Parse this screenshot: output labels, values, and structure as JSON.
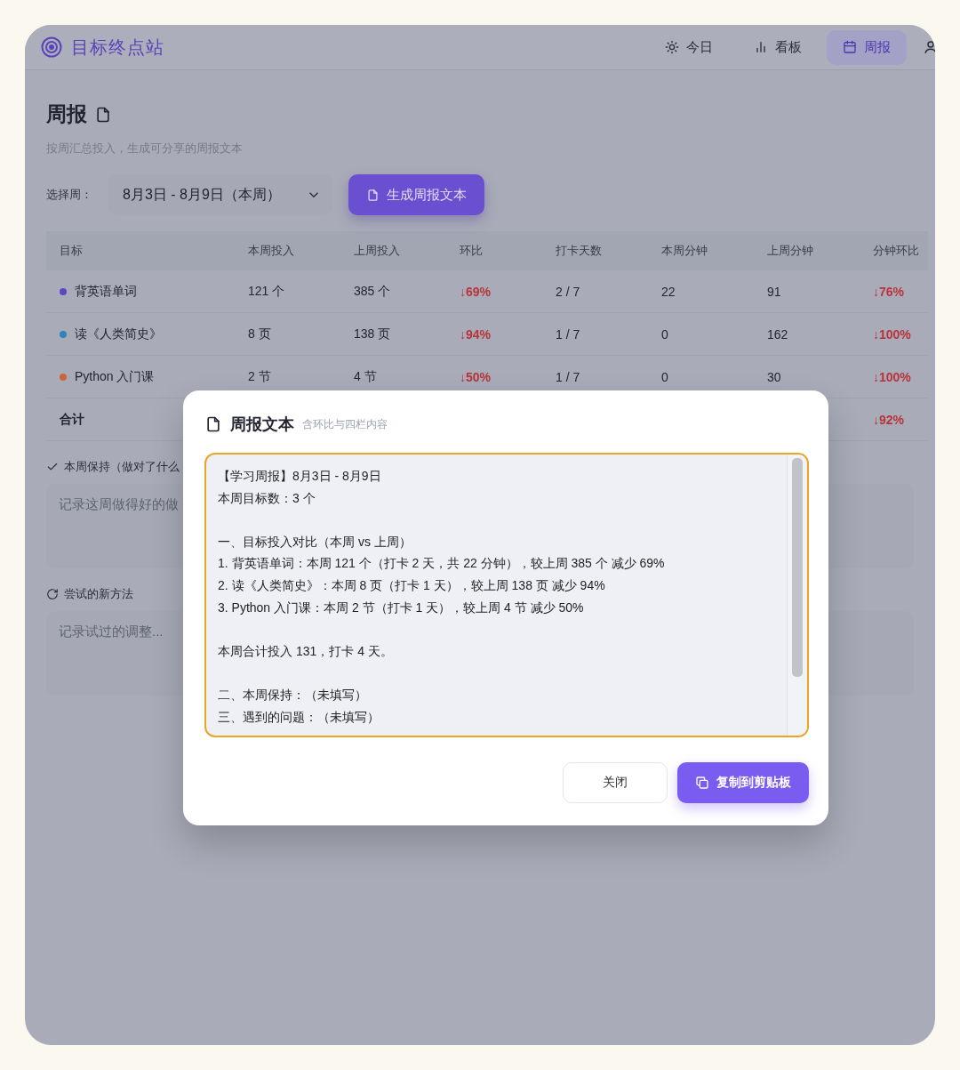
{
  "app": {
    "name": "目标终点站"
  },
  "nav": [
    {
      "label": "今日",
      "selected": false
    },
    {
      "label": "看板",
      "selected": false
    },
    {
      "label": "周报",
      "selected": true
    }
  ],
  "page": {
    "title": "周报",
    "subtitle": "按周汇总投入，生成可分享的周报文本",
    "week_label": "选择周：",
    "week_value": "8月3日 - 8月9日（本周）",
    "generate_button": "生成周报文本"
  },
  "table": {
    "columns": [
      {
        "label": "目标",
        "kind": "goal"
      },
      {
        "label": "本周投入",
        "kind": "text"
      },
      {
        "label": "上周投入",
        "kind": "text"
      },
      {
        "label": "环比",
        "kind": "change"
      },
      {
        "label": "打卡天数",
        "kind": "text"
      },
      {
        "label": "本周分钟",
        "kind": "text"
      },
      {
        "label": "上周分钟",
        "kind": "text"
      },
      {
        "label": "分钟环比",
        "kind": "change"
      }
    ],
    "rows": [
      {
        "cells": [
          "背英语单词",
          "121 个",
          "385 个",
          "↓69%",
          "2 / 7",
          "22",
          "91",
          "↓76%"
        ],
        "color": "#5b45c0"
      },
      {
        "cells": [
          "读《人类简史》",
          "8 页",
          "138 页",
          "↓94%",
          "1 / 7",
          "0",
          "162",
          "↓100%"
        ],
        "color": "#2a85b8"
      },
      {
        "cells": [
          "Python 入门课",
          "2 节",
          "4 节",
          "↓50%",
          "1 / 7",
          "0",
          "30",
          "↓100%"
        ],
        "color": "#c8683a"
      }
    ],
    "total": {
      "label": "合计",
      "minutes_change": "↓92%"
    }
  },
  "sections": [
    {
      "label": "本周保持（做对了什么",
      "placeholder": "记录这周做得好的做"
    },
    {
      "label": "尝试的新方法",
      "placeholder": "记录试过的调整..."
    }
  ],
  "modal": {
    "title": "周报文本",
    "subtitle": "含环比与四栏内容",
    "paragraphs": [
      [
        "【学习周报】8月3日 - 8月9日",
        "本周目标数：3 个"
      ],
      [
        "一、目标投入对比（本周 vs 上周）",
        "1. 背英语单词：本周 121 个（打卡 2 天，共 22 分钟），较上周 385 个 减少 69%",
        "2. 读《人类简史》：本周 8 页（打卡 1 天），较上周 138 页 减少 94%",
        "3. Python 入门课：本周 2 节（打卡 1 天），较上周 4 节 减少 50%"
      ],
      [
        "本周合计投入 131，打卡 4 天。"
      ],
      [
        "二、本周保持：（未填写）",
        "三、遇到的问题：（未填写）"
      ]
    ],
    "close_button": "关闭",
    "copy_button": "复制到剪贴板"
  }
}
